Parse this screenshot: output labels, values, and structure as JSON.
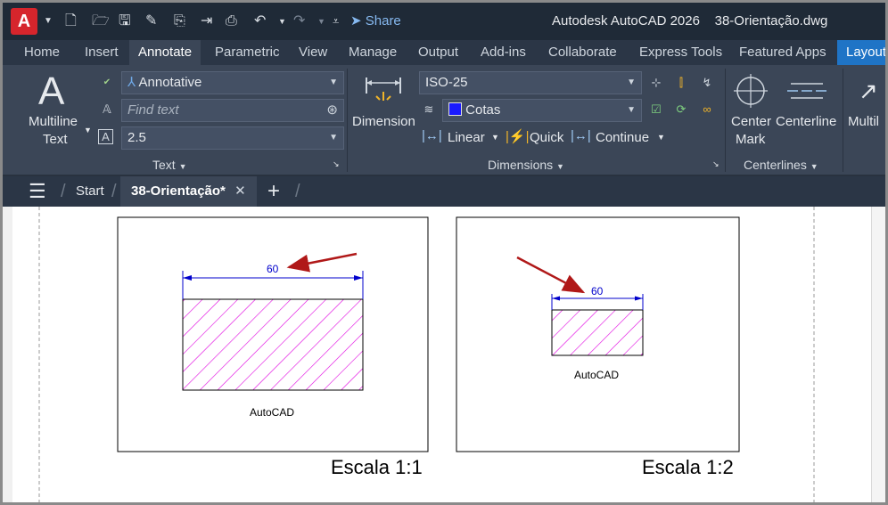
{
  "app": {
    "logo_letter": "A",
    "share_label": "Share",
    "product": "Autodesk AutoCAD 2026",
    "document": "38-Orientação.dwg"
  },
  "ribbon_tabs": [
    "Home",
    "Insert",
    "Annotate",
    "Parametric",
    "View",
    "Manage",
    "Output",
    "Add-ins",
    "Collaborate",
    "Express Tools",
    "Featured Apps",
    "Layout"
  ],
  "ribbon_active_tab": "Annotate",
  "text_panel": {
    "title": "Text",
    "big_letter": "A",
    "multiline_line1": "Multiline",
    "multiline_line2": "Text",
    "style_value": "Annotative",
    "find_placeholder": "Find text",
    "height_value": "2.5"
  },
  "dimensions_panel": {
    "title": "Dimensions",
    "dimension_label": "Dimension",
    "dimstyle_value": "ISO-25",
    "layer_value": "Cotas",
    "layer_color": "#1a1aff",
    "linear_label": "Linear",
    "quick_label": "Quick",
    "continue_label": "Continue"
  },
  "centerlines_panel": {
    "title": "Centerlines",
    "center_mark_line1": "Center",
    "center_mark_line2": "Mark",
    "centerline_label": "Centerline",
    "cut_label": "Multil"
  },
  "file_tabs": {
    "start": "Start",
    "active": "38-Orientação*"
  },
  "drawing": {
    "left_view": {
      "dimension": "60",
      "label": "AutoCAD",
      "scale_caption": "Escala 1:1"
    },
    "right_view": {
      "dimension": "60",
      "label": "AutoCAD",
      "scale_caption": "Escala 1:2"
    },
    "colors": {
      "dimension": "#0000cc",
      "hatch": "#e000e0",
      "arrow": "#b01818"
    }
  }
}
